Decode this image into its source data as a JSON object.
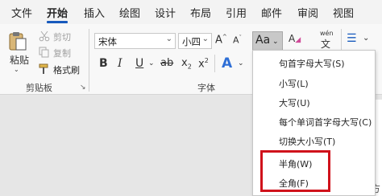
{
  "tabs": [
    "文件",
    "开始",
    "插入",
    "绘图",
    "设计",
    "布局",
    "引用",
    "邮件",
    "审阅",
    "视图"
  ],
  "active_tab": "开始",
  "clipboard": {
    "paste": "粘贴",
    "cut": "剪切",
    "copy": "复制",
    "format_painter": "格式刷",
    "group_label": "剪贴板"
  },
  "font": {
    "name": "宋体",
    "size": "小四",
    "group_label": "字体",
    "aa_label": "Aa",
    "wen_top": "wén",
    "wen_char": "文",
    "launcher": "↘"
  },
  "case_menu": {
    "items": [
      "句首字母大写(S)",
      "小写(L)",
      "大写(U)",
      "每个单词首字母大写(C)",
      "切换大小写(T)",
      "半角(W)",
      "全角(F)"
    ],
    "highlight_color": "#d0121b"
  },
  "document": {
    "visible_char": "方"
  },
  "icons": [
    "paste-icon",
    "scissors-icon",
    "copy-icon",
    "format-painter-icon",
    "grow-font-icon",
    "shrink-font-icon",
    "bold-icon",
    "italic-icon",
    "underline-icon",
    "strikethrough-icon",
    "subscript-icon",
    "superscript-icon",
    "text-effects-icon",
    "highlighter-icon",
    "font-color-icon",
    "change-case-icon",
    "clear-formatting-icon",
    "phonetic-guide-icon",
    "character-border-icon",
    "bullets-icon"
  ],
  "colors": {
    "accent": "#185abd",
    "ribbon": "#f8f8f8",
    "tabbar": "#f3f3f3",
    "menu_highlight": "#d0121b"
  }
}
